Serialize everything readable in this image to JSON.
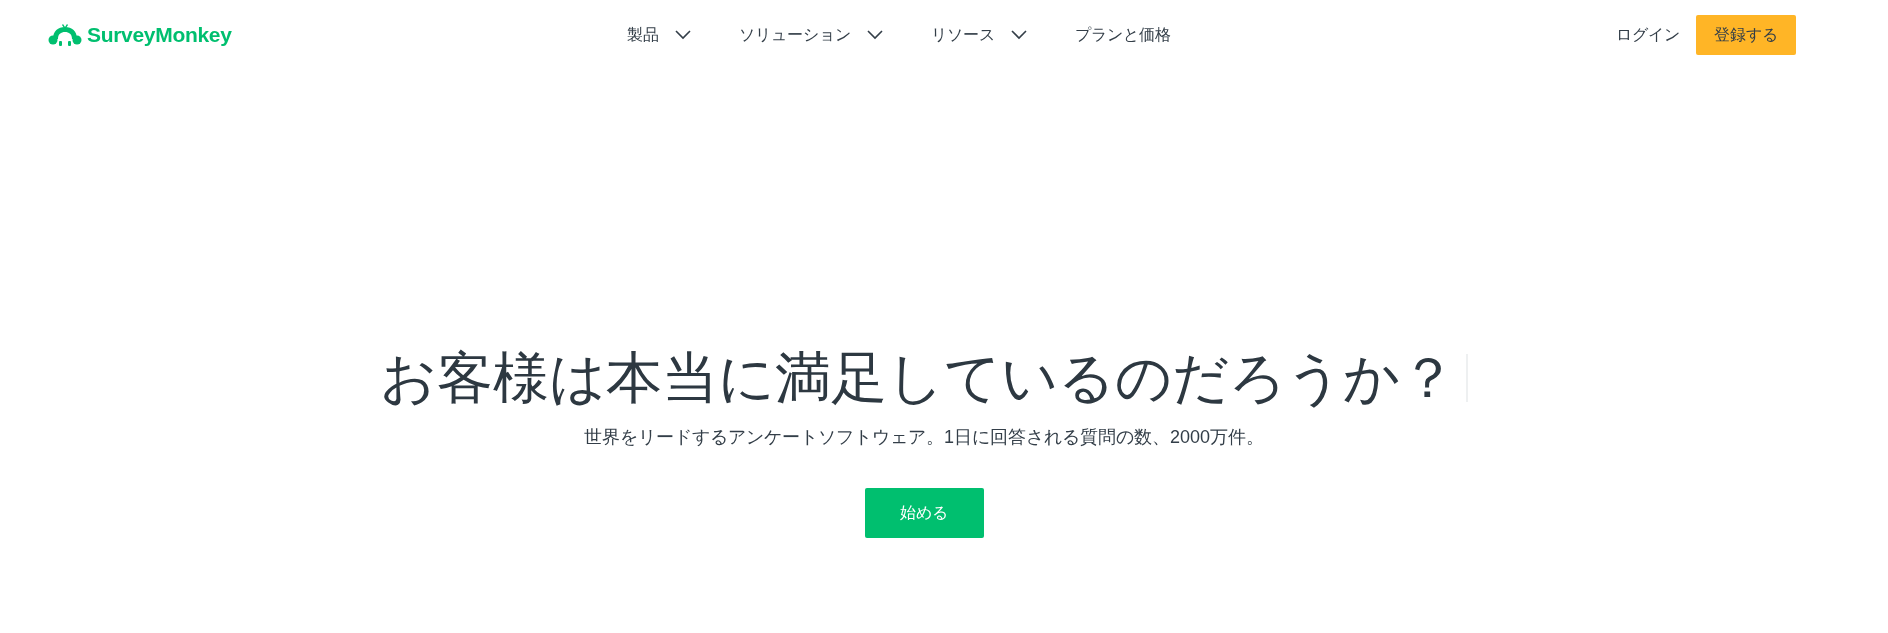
{
  "header": {
    "logo": {
      "text": "SurveyMonkey"
    },
    "nav": [
      {
        "label": "製品",
        "kind": "menu"
      },
      {
        "label": "ソリューション",
        "kind": "menu"
      },
      {
        "label": "リソース",
        "kind": "menu"
      },
      {
        "label": "プランと価格",
        "kind": "link"
      }
    ],
    "login": "ログイン",
    "signup": "登録する"
  },
  "hero": {
    "headline": "お客様は本当に満足しているのだろうか？",
    "cursor": true,
    "subtitle": "世界をリードするアンケートソフトウェア。1日に回答される質問の数、2000万件。",
    "cta": "始める"
  }
}
